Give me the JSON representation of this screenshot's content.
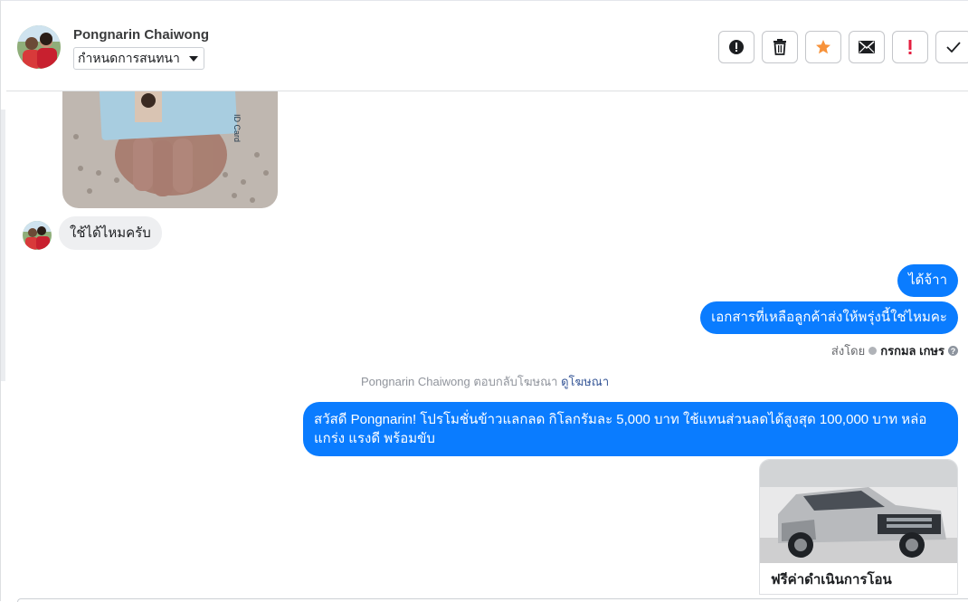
{
  "header": {
    "contact_name": "Pongnarin Chaiwong",
    "label_select_value": "กำหนดการสนทนา",
    "toolbar": [
      {
        "name": "spam-button",
        "icon": "exclamation-circle-icon"
      },
      {
        "name": "delete-button",
        "icon": "trash-icon"
      },
      {
        "name": "star-button",
        "icon": "star-icon"
      },
      {
        "name": "mark-unread-button",
        "icon": "envelope-icon"
      },
      {
        "name": "follow-up-button",
        "icon": "exclamation-icon"
      },
      {
        "name": "mark-done-button",
        "icon": "check-icon"
      }
    ]
  },
  "messages": {
    "incoming_text": "ใช้ได้ไหมครับ",
    "outgoing_1": "ได้จ้าา",
    "outgoing_2": "เอกสารที่เหลือลูกค้าส่งให้พรุ่งนี้ใช่ไหมคะ",
    "sent_by_prefix": "ส่งโดย",
    "sent_by_name": "กรกมล เกษร",
    "ad_reply_name": "Pongnarin Chaiwong",
    "ad_reply_text": "ตอบกลับโฆษณา",
    "ad_reply_link": "ดูโฆษณา",
    "promo_line1": "สวัสดี Pongnarin! โปรโมชั่นข้าวแลกลด กิโลกรัมละ 5,000 บาท ใช้แทนส่วนลดได้สูงสุด 100,000 บาท หล่อ",
    "promo_line2": "แกร่ง แรงดี พร้อมขับ",
    "ad_card_title": "ฟรีค่าดำเนินการโอน",
    "id_card_text": "ID Card"
  },
  "colors": {
    "outgoing_bubble": "#0a7cff",
    "incoming_bubble": "#eeeff1",
    "star": "#f7923a",
    "follow_up": "#e41e3f"
  }
}
